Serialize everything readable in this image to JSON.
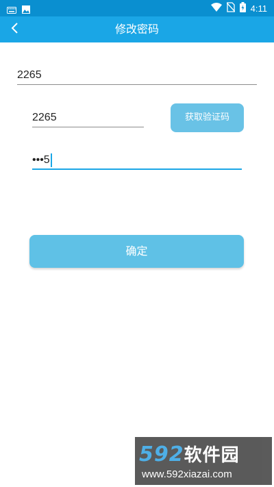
{
  "status_bar": {
    "time": "4:11",
    "icons": [
      "keyboard-icon",
      "image-icon",
      "wifi-icon",
      "no-sim-icon",
      "battery-icon"
    ]
  },
  "toolbar": {
    "title": "修改密码",
    "back_icon": "chevron-left-icon"
  },
  "form": {
    "account_value": "2265",
    "code_value": "2265",
    "get_code_label": "获取验证码",
    "password_value": "•••5",
    "confirm_label": "确定"
  },
  "watermark": {
    "logo_num": "592",
    "logo_cn": "软件园",
    "url": "www.592xiazai.com"
  },
  "colors": {
    "status_bar": "#0a8fd0",
    "toolbar": "#1aa6e6",
    "button": "#5fc1e6",
    "focus_line": "#1aa6e6"
  }
}
